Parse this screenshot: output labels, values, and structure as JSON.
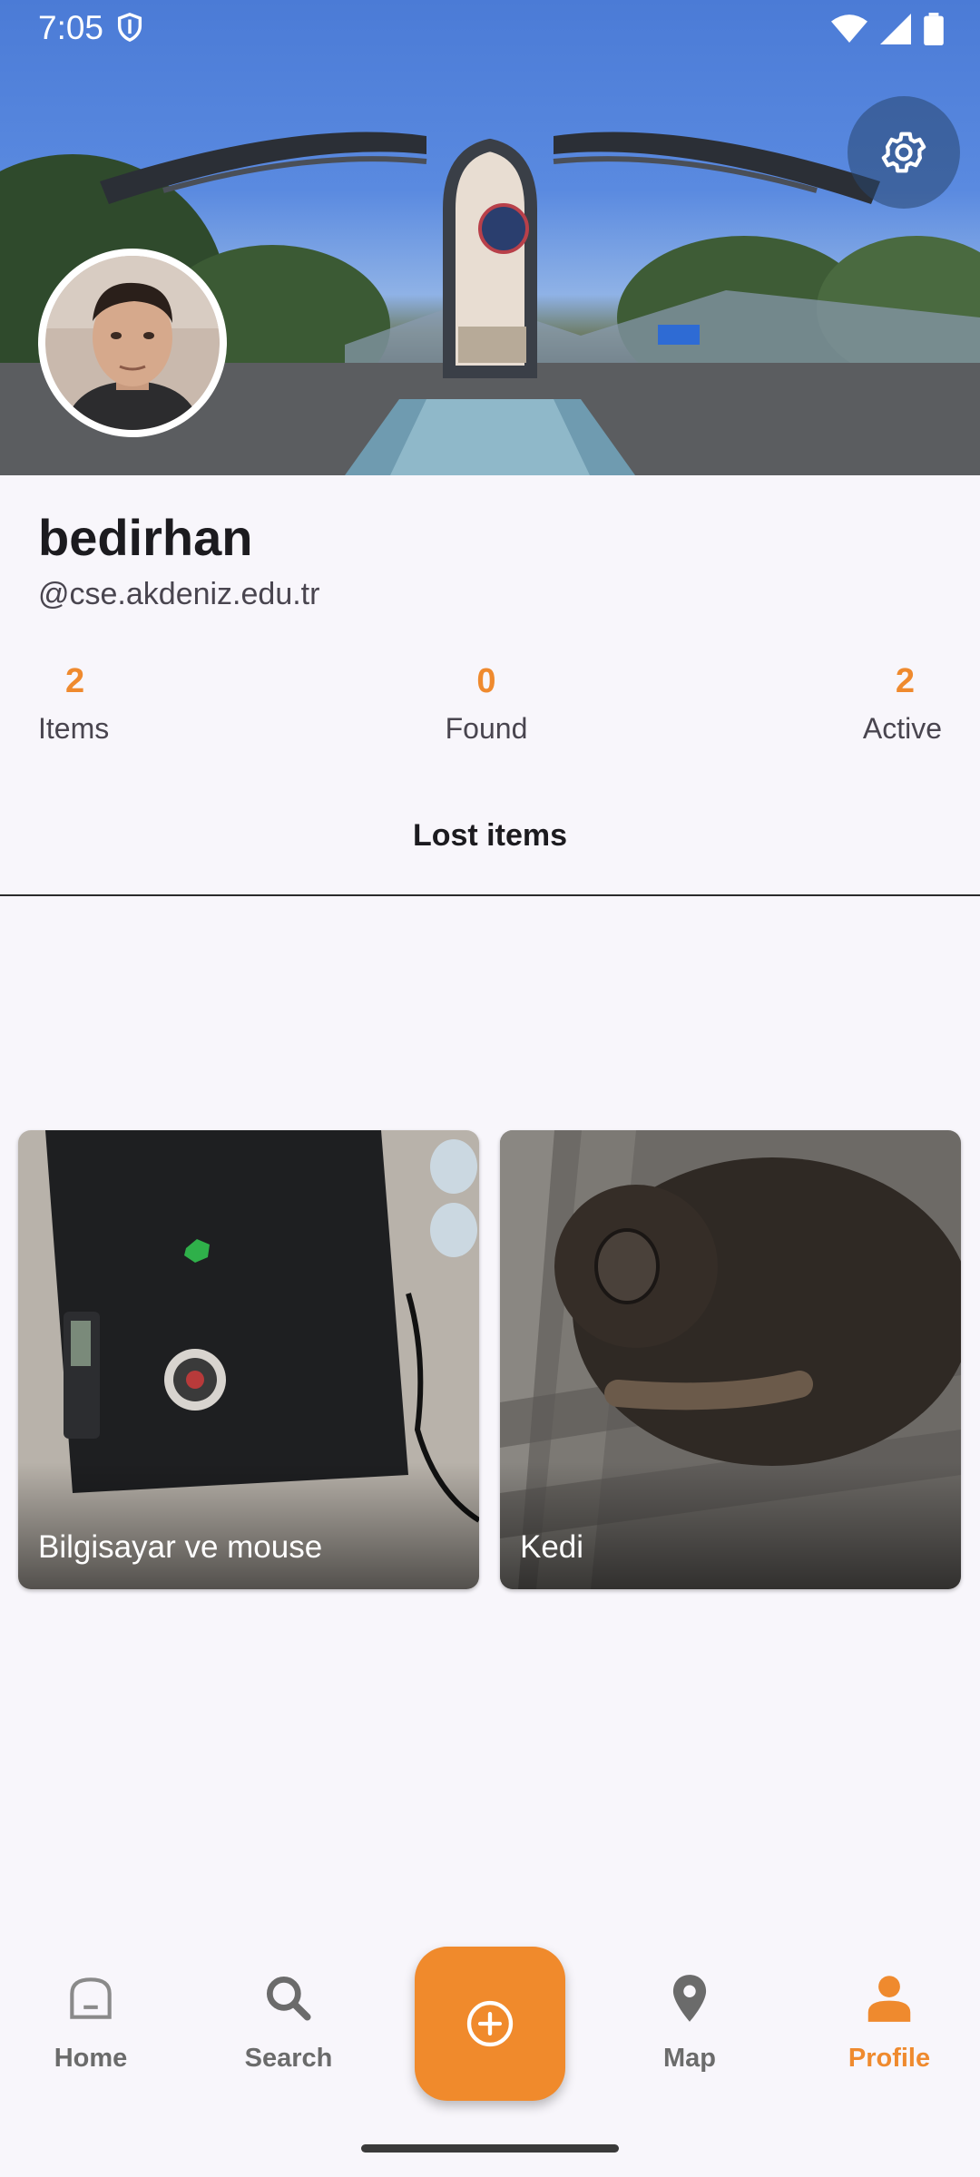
{
  "status_bar": {
    "time": "7:05"
  },
  "profile": {
    "username": "bedirhan",
    "handle": "@cse.akdeniz.edu.tr"
  },
  "stats": [
    {
      "value": "2",
      "label": "Items"
    },
    {
      "value": "0",
      "label": "Found"
    },
    {
      "value": "2",
      "label": "Active"
    }
  ],
  "tab": {
    "label": "Lost items"
  },
  "items": [
    {
      "title": "Bilgisayar ve mouse"
    },
    {
      "title": "Kedi"
    }
  ],
  "bottom_nav": [
    {
      "label": "Home",
      "icon": "home-icon"
    },
    {
      "label": "Search",
      "icon": "search-icon"
    },
    {
      "label": "",
      "icon": "add-circle-icon"
    },
    {
      "label": "Map",
      "icon": "map-pin-icon"
    },
    {
      "label": "Profile",
      "icon": "person-icon",
      "active": true
    }
  ],
  "colors": {
    "accent": "#ef8a2e",
    "background": "#f8f6fb"
  }
}
